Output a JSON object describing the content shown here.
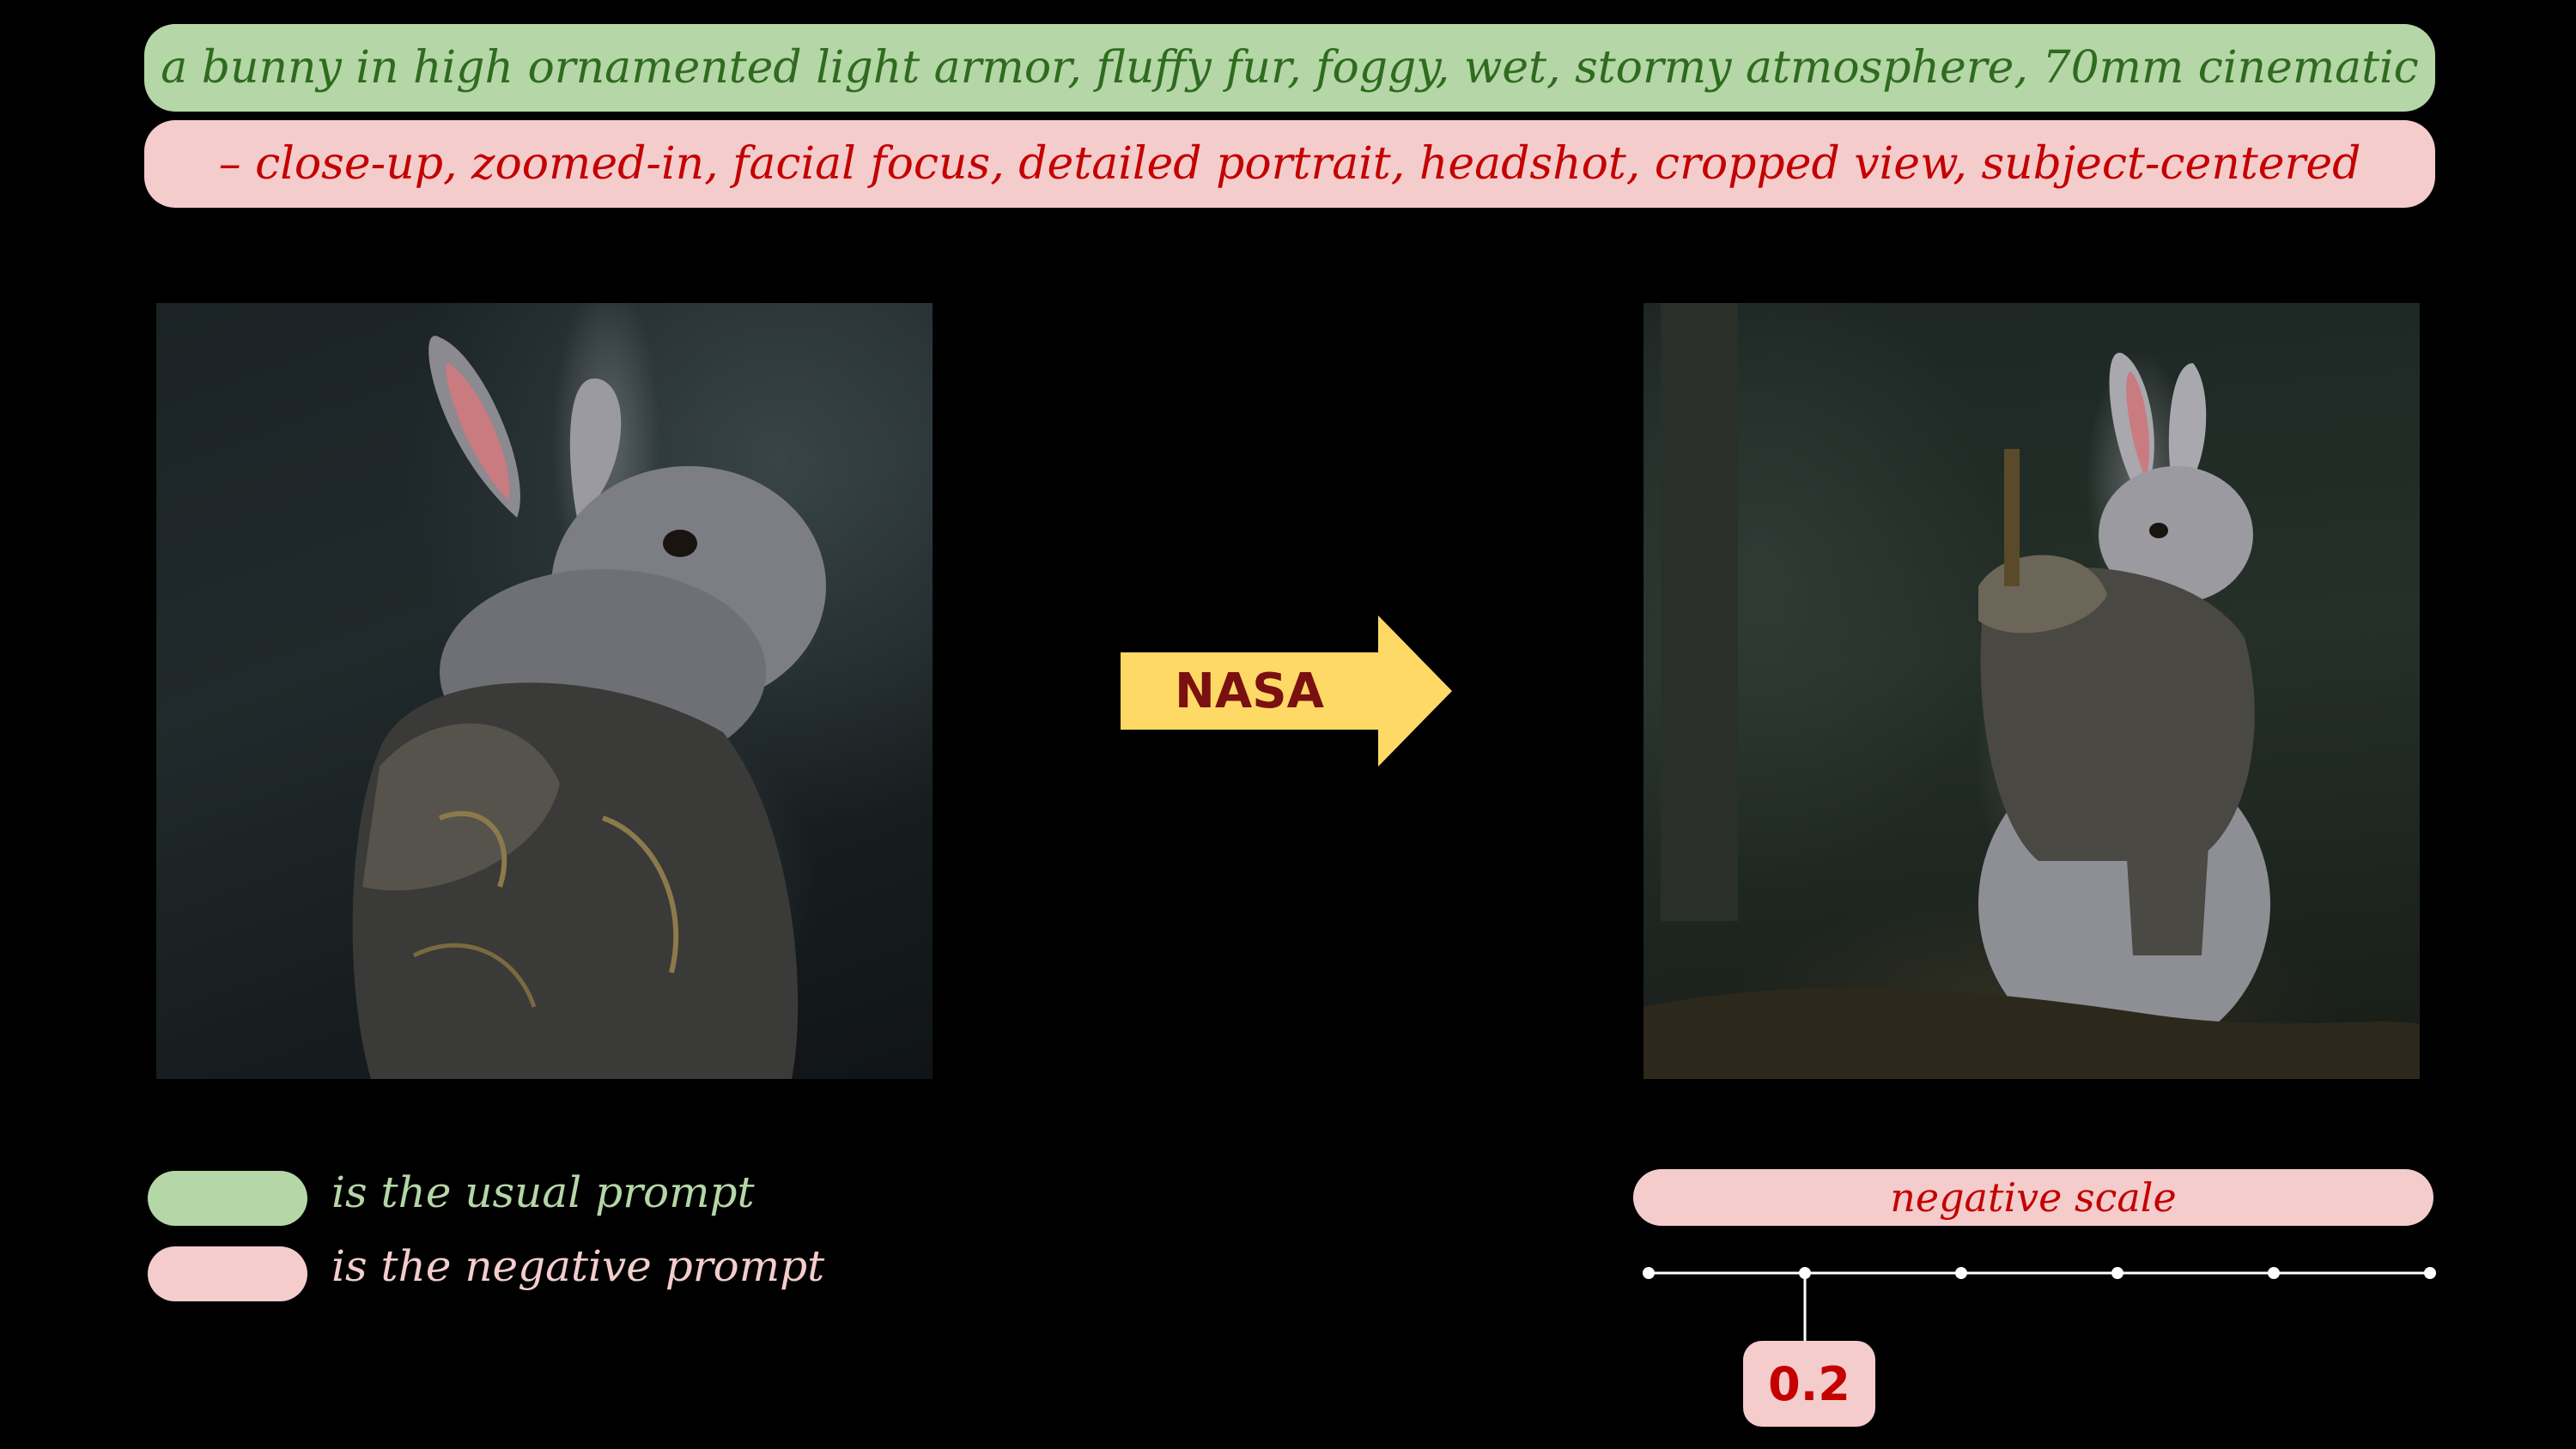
{
  "prompt": {
    "usual": "a bunny in high ornamented light armor, fluffy fur, foggy, wet, stormy atmosphere, 70mm cinematic",
    "negative": "– close-up, zoomed-in, facial focus, detailed portrait, headshot, cropped view, subject-centered"
  },
  "arrow": {
    "label": "NASA",
    "color": "#ffd966"
  },
  "legend": {
    "usual_text": "is the usual prompt",
    "negative_text": "is the negative prompt",
    "usual_color": "#b5d6a7",
    "negative_color": "#f4cccc"
  },
  "scale": {
    "title": "negative scale",
    "value": "0.2",
    "tick_count": 6,
    "selected_tick_index": 1
  }
}
